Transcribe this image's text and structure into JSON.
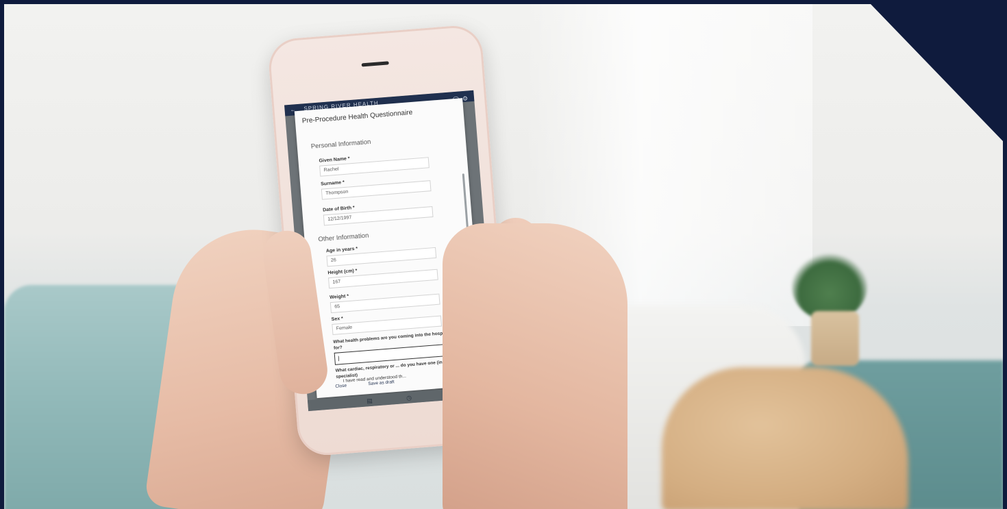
{
  "scene": {
    "frame_color": "#0f1b3d",
    "skin_color": "#e6bba5",
    "sofa_color": "#8fb7b7"
  },
  "phone": {
    "app_header": "SPRING RIVER HEALTH",
    "modal_title": "Pre-Procedure Health Questionnaire",
    "sections": [
      "Personal Information",
      "Other Information"
    ],
    "fields": [
      {
        "label": "Given Name *",
        "value": "Rachel"
      },
      {
        "label": "Surname *",
        "value": "Thompson"
      },
      {
        "label": "Date of Birth *",
        "value": "12/12/1997"
      },
      {
        "label": "Age in years *",
        "value": "26"
      },
      {
        "label": "Height (cm) *",
        "value": "167"
      },
      {
        "label": "Weight *",
        "value": "65"
      },
      {
        "label": "Sex *",
        "value": "Female"
      }
    ],
    "question_1": "What health problems are you coming into the hospital for?",
    "question_1_value": "|",
    "question_2": "What cardiac, respiratory or ... do you have one (include specialist)",
    "checkbox_text": "I have read and understood th...",
    "buttons": {
      "close": "Close",
      "save_draft": "Save as draft"
    },
    "icons": [
      "back-arrow-icon",
      "share-icon",
      "settings-icon",
      "menu-icon",
      "history-icon"
    ]
  }
}
